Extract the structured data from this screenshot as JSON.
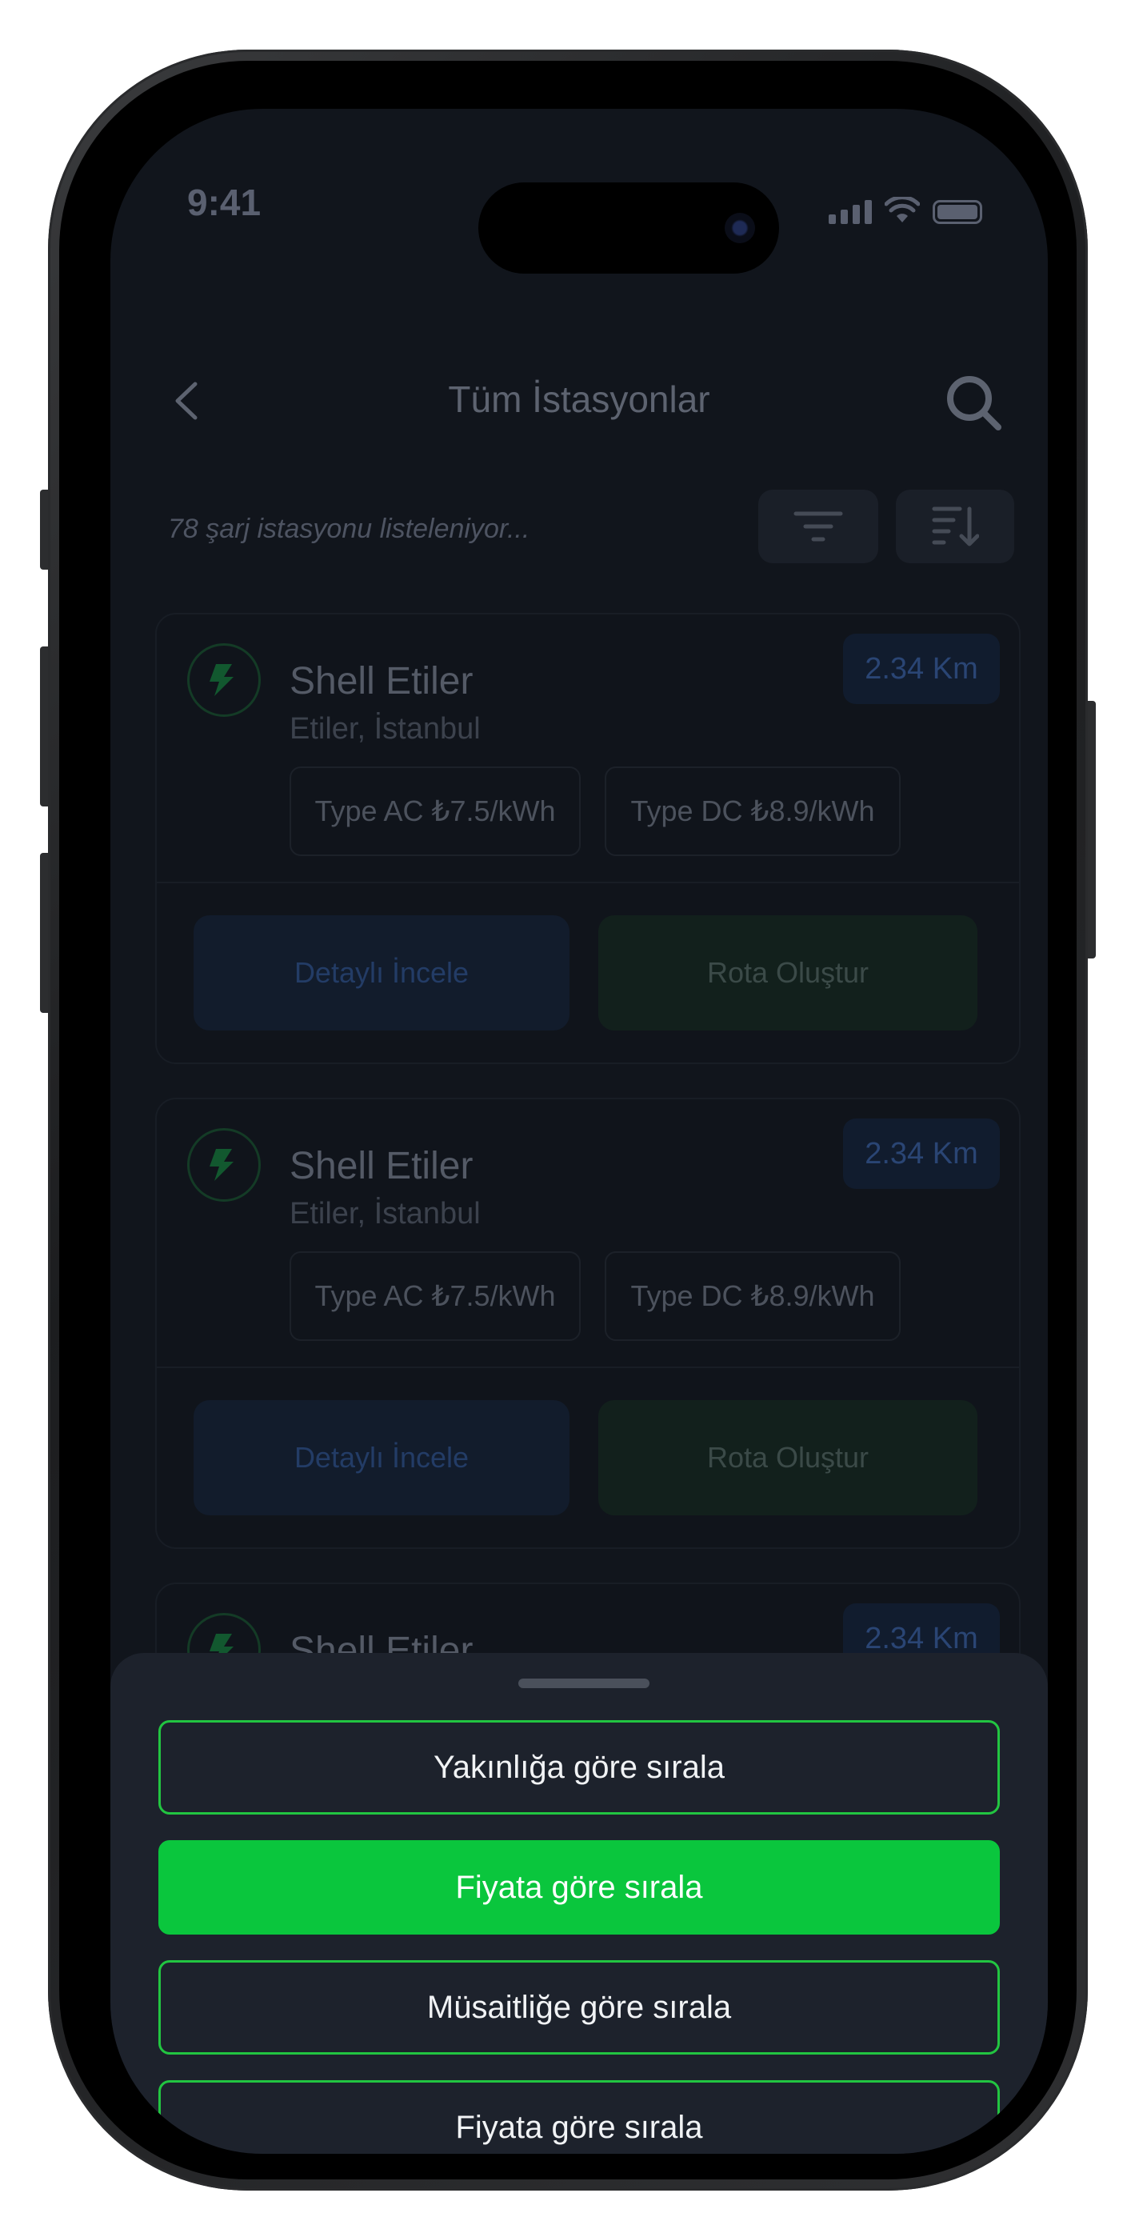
{
  "status_bar": {
    "time": "9:41"
  },
  "header": {
    "title": "Tüm İstasyonlar"
  },
  "list": {
    "count_text": "78 şarj istasyonu listeleniyor..."
  },
  "stations": [
    {
      "name": "Shell Etiler",
      "address": "Etiler, İstanbul",
      "distance": "2.34 Km",
      "tags": [
        "Type AC ₺7.5/kWh",
        "Type DC ₺8.9/kWh"
      ],
      "detail_label": "Detaylı İncele",
      "route_label": "Rota Oluştur"
    },
    {
      "name": "Shell Etiler",
      "address": "Etiler, İstanbul",
      "distance": "2.34 Km",
      "tags": [
        "Type AC ₺7.5/kWh",
        "Type DC ₺8.9/kWh"
      ],
      "detail_label": "Detaylı İncele",
      "route_label": "Rota Oluştur"
    },
    {
      "name": "Shell Etiler",
      "distance": "2.34 Km"
    }
  ],
  "sort_sheet": {
    "options": [
      {
        "label": "Yakınlığa göre sırala",
        "selected": false
      },
      {
        "label": "Fiyata göre sırala",
        "selected": true
      },
      {
        "label": "Müsaitliğe göre sırala",
        "selected": false
      },
      {
        "label": "Fiyata göre sırala",
        "selected": false
      }
    ]
  },
  "colors": {
    "accent_green": "#0ac63d",
    "sheet_background": "#1d222c",
    "screen_background": "#11151c"
  }
}
